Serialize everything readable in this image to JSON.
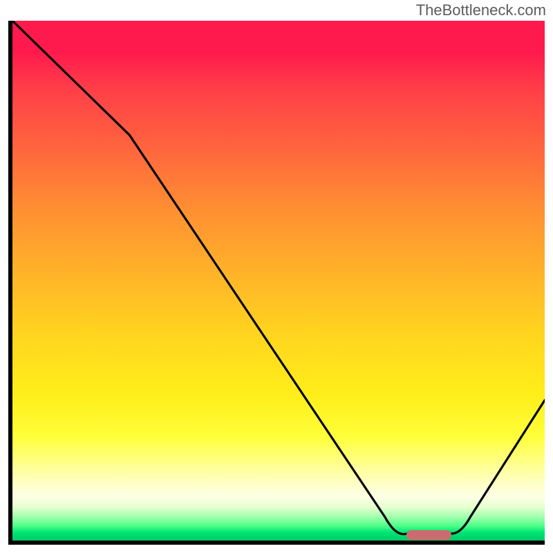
{
  "watermark": "TheBottleneck.com",
  "chart_data": {
    "type": "line",
    "title": "",
    "xlabel": "",
    "ylabel": "",
    "xlim": [
      0,
      100
    ],
    "ylim": [
      0,
      100
    ],
    "grid": false,
    "legend": false,
    "series": [
      {
        "name": "bottleneck-curve",
        "x": [
          0,
          22,
          70,
          74,
          82,
          86,
          100
        ],
        "y": [
          100,
          78,
          4.5,
          1.3,
          1.4,
          4.5,
          27
        ]
      }
    ],
    "annotations": [
      {
        "name": "optimal-range-marker",
        "x_start": 74,
        "x_end": 82.5,
        "y": 1.1,
        "color": "#cc6b6f"
      }
    ],
    "background_gradient": {
      "top_color": "#ff1a4d",
      "mid_color": "#ffee1a",
      "bottom_color": "#00c96a"
    }
  }
}
